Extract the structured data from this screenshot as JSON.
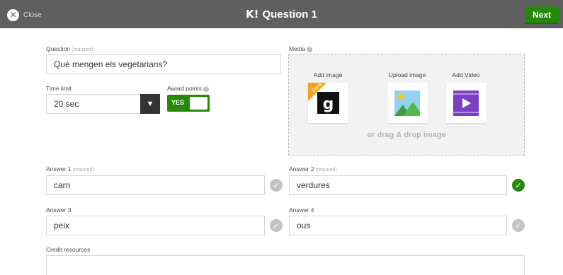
{
  "topbar": {
    "close_label": "Close",
    "logo": "K!",
    "title": "Question 1",
    "next_label": "Next"
  },
  "question": {
    "label": "Question",
    "required_hint": "(required)",
    "value": "Què mengen els vegetarians?"
  },
  "time_limit": {
    "label": "Time limit",
    "value": "20 sec"
  },
  "award_points": {
    "label": "Award points",
    "toggle_text": "YES",
    "enabled": true
  },
  "media": {
    "label": "Media",
    "options": [
      {
        "label": "Add image",
        "icon": "getty-images-icon",
        "badge": "Beta"
      },
      {
        "label": "Upload image",
        "icon": "image-upload-icon"
      },
      {
        "label": "Add Video",
        "icon": "video-icon"
      }
    ],
    "drag_hint": "or drag & drop image"
  },
  "answers": [
    {
      "label": "Answer 1",
      "required_hint": "(required)",
      "value": "carn",
      "correct": false
    },
    {
      "label": "Answer 2",
      "required_hint": "(required)",
      "value": "verdures",
      "correct": true
    },
    {
      "label": "Answer 3",
      "required_hint": "",
      "value": "peix",
      "correct": false
    },
    {
      "label": "Answer 4",
      "required_hint": "",
      "value": "ous",
      "correct": false
    }
  ],
  "credit": {
    "label": "Credit resources",
    "value": ""
  },
  "colors": {
    "topbar": "#5f5f5f",
    "accent_green": "#26890c",
    "check_gray": "#c4c4c4",
    "media_bg": "#f2f2f2"
  }
}
